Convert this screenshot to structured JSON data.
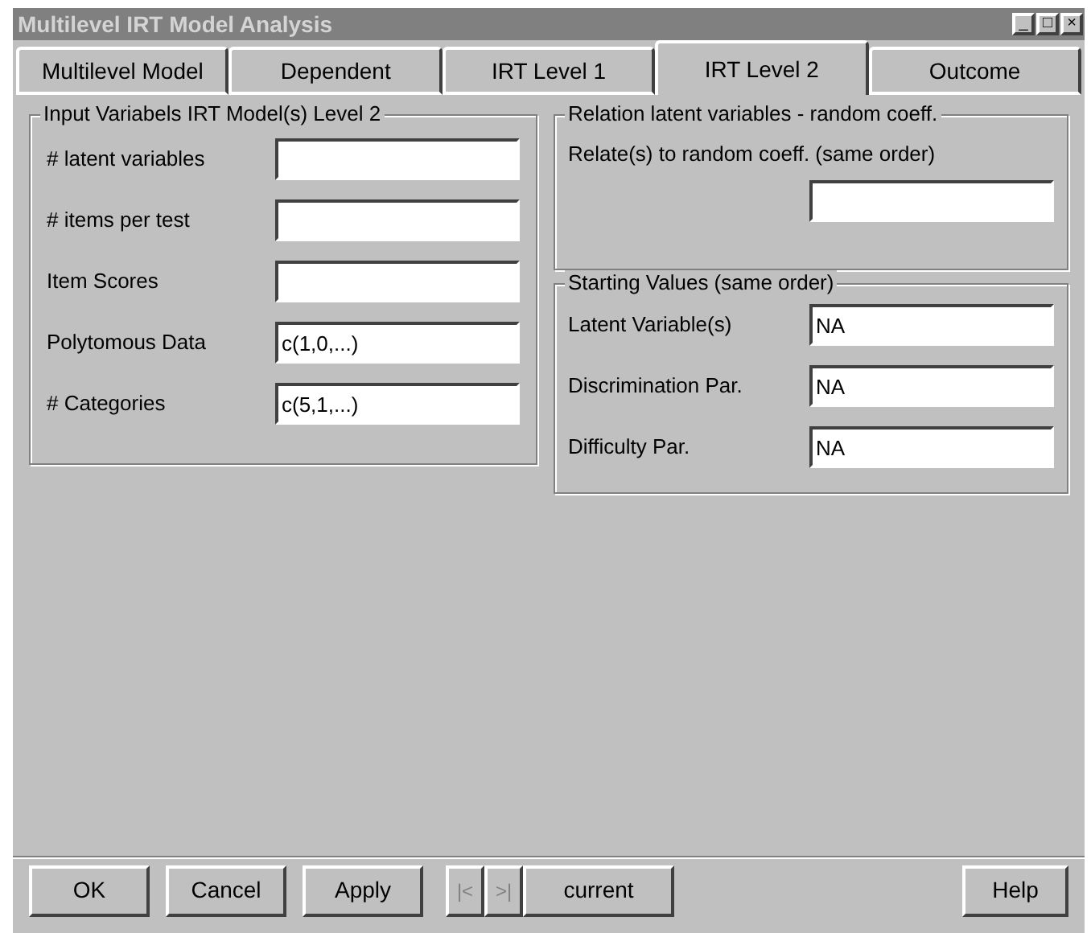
{
  "window": {
    "title": "Multilevel IRT Model Analysis",
    "controls": [
      "_",
      "□",
      "×"
    ]
  },
  "tabs": [
    {
      "label": "Multilevel Model",
      "selected": false
    },
    {
      "label": "Dependent",
      "selected": false
    },
    {
      "label": "IRT Level 1",
      "selected": false
    },
    {
      "label": "IRT Level 2",
      "selected": true
    },
    {
      "label": "Outcome",
      "selected": false
    }
  ],
  "input_group": {
    "title": "Input Variabels IRT Model(s) Level 2",
    "fields": [
      {
        "label": "# latent variables"
      },
      {
        "label": "# items per test"
      },
      {
        "label": "Item Scores"
      },
      {
        "label": "Polytomous Data",
        "value": "c(1,0,...)"
      },
      {
        "label": "# Categories",
        "value": "c(5,1,...)"
      }
    ]
  },
  "relation_group": {
    "title": "Relation latent variables - random coeff.",
    "label": "Relate(s) to random coeff. (same order)"
  },
  "starting_group": {
    "title": "Starting Values (same order)",
    "fields": [
      {
        "label": "Latent Variable(s)",
        "value": "NA"
      },
      {
        "label": "Discrimination Par.",
        "value": "NA"
      },
      {
        "label": "Difficulty Par.",
        "value": "NA"
      }
    ]
  },
  "buttons": [
    "OK",
    "Cancel",
    "Apply"
  ],
  "navigator": {
    "first": {
      "label": "|<",
      "disabled": true
    },
    "last": {
      "label": ">|",
      "disabled": true
    },
    "current": "current"
  },
  "help_button": "Help"
}
